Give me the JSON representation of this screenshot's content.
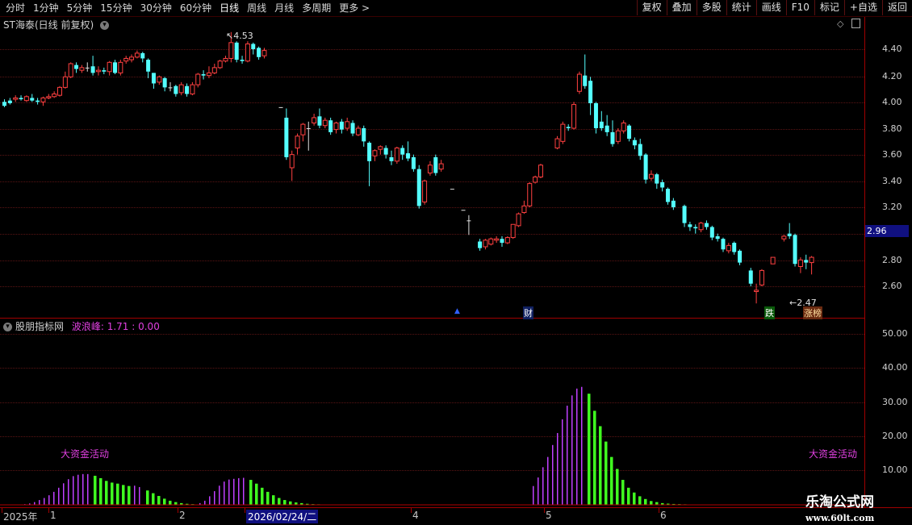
{
  "toolbar": {
    "periods": [
      "分时",
      "1分钟",
      "5分钟",
      "15分钟",
      "30分钟",
      "60分钟",
      "日线",
      "周线",
      "月线",
      "多周期",
      "更多 >"
    ],
    "active_index": 6,
    "tools": [
      "复权",
      "叠加",
      "多股",
      "统计",
      "画线",
      "F10",
      "标记",
      "+自选",
      "返回"
    ]
  },
  "main": {
    "title": "ST海泰(日线 前复权)",
    "price_axis": [
      "4.40",
      "4.20",
      "4.00",
      "3.80",
      "3.60",
      "3.40",
      "3.20",
      "2.80",
      "2.60"
    ],
    "current_price": "2.96",
    "high_label": "4.53",
    "low_label": "2.47",
    "markers": {
      "cai": "财",
      "die": "跌",
      "zhang": "涨榜"
    },
    "colors": {
      "up": "#ff4040",
      "down": "#54ffff",
      "bg": "#000000"
    }
  },
  "indicator": {
    "title": "股朋指标网",
    "series_label": "波浪峰:",
    "series_values": "1.71 : 0.00",
    "axis": [
      "50.00",
      "40.00",
      "30.00",
      "20.00",
      "10.00"
    ],
    "hint_left": "大资金活动",
    "hint_right": "大资金活动",
    "colors": {
      "rise": "#c040ff",
      "fall": "#40ff20"
    }
  },
  "xaxis": {
    "labels": [
      "2025年",
      "1",
      "2",
      "2026/02/24/二",
      "4",
      "5",
      "6"
    ]
  },
  "watermark": {
    "line1": "乐淘公式网",
    "line2": "www.60lt.com"
  }
}
